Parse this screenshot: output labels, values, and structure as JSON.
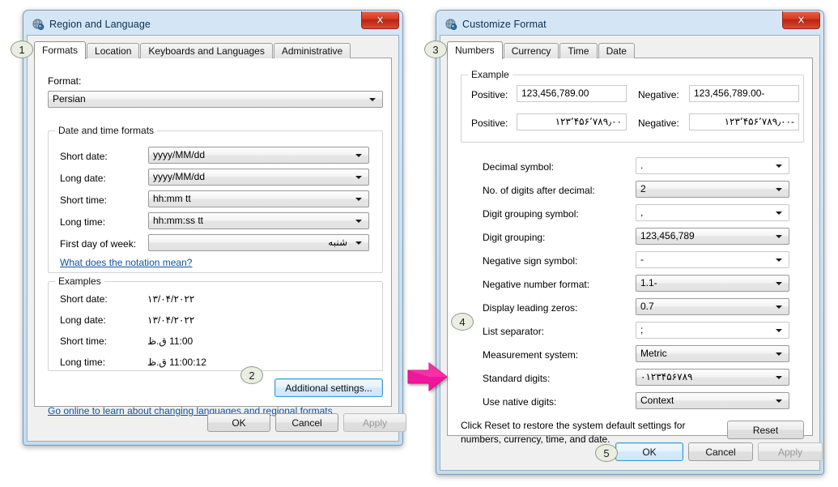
{
  "steps": [
    {
      "n": "1"
    },
    {
      "n": "2"
    },
    {
      "n": "3"
    },
    {
      "n": "4"
    },
    {
      "n": "5"
    }
  ],
  "accent": {
    "arrow_pink": "#F0179C",
    "titlebar_blue": "#CFE2F3",
    "close_red": "#C93017",
    "link_blue": "#1252A0",
    "badge_fill": "#E9EEE0"
  },
  "region_window": {
    "title": "Region and Language",
    "close_label": "x",
    "tabs": [
      {
        "label": "Formats",
        "active": true
      },
      {
        "label": "Location",
        "active": false
      },
      {
        "label": "Keyboards and Languages",
        "active": false
      },
      {
        "label": "Administrative",
        "active": false
      }
    ],
    "format_label": "Format:",
    "format_value": "Persian",
    "datetime_group": {
      "title": "Date and time formats",
      "rows": [
        {
          "label": "Short date:",
          "value": "yyyy/MM/dd",
          "rtl": false
        },
        {
          "label": "Long date:",
          "value": "yyyy/MM/dd",
          "rtl": false
        },
        {
          "label": "Short time:",
          "value": "hh:mm tt",
          "rtl": false
        },
        {
          "label": "Long time:",
          "value": "hh:mm:ss tt",
          "rtl": false
        },
        {
          "label": "First day of week:",
          "value": "شنبه",
          "rtl": true
        }
      ],
      "notation_link": "What does the notation mean?"
    },
    "examples_group": {
      "title": "Examples",
      "rows": [
        {
          "label": "Short date:",
          "value": "۱۳/۰۴/۲۰۲۲"
        },
        {
          "label": "Long date:",
          "value": "۱۳/۰۴/۲۰۲۲"
        },
        {
          "label": "Short time:",
          "value": "11:00 ق.ظ"
        },
        {
          "label": "Long time:",
          "value": "11:00:12 ق.ظ"
        }
      ]
    },
    "additional_settings_label": "Additional settings...",
    "go_online_link": "Go online to learn about changing languages and regional formats",
    "buttons": {
      "ok": "OK",
      "cancel": "Cancel",
      "apply": "Apply"
    }
  },
  "customize_window": {
    "title": "Customize Format",
    "close_label": "x",
    "tabs": [
      {
        "label": "Numbers",
        "active": true
      },
      {
        "label": "Currency",
        "active": false
      },
      {
        "label": "Time",
        "active": false
      },
      {
        "label": "Date",
        "active": false
      }
    ],
    "example_group": {
      "title": "Example",
      "positive_label": "Positive:",
      "negative_label": "Negative:",
      "positive_latin": "123,456,789.00",
      "negative_latin": "123,456,789.00-",
      "positive_native": "۱۲۳٬۴۵۶٬۷۸۹٫۰۰",
      "negative_native": "-۱۲۳٬۴۵۶٬۷۸۹٫۰۰"
    },
    "settings": [
      {
        "label": "Decimal symbol:",
        "value": ".",
        "flat": true
      },
      {
        "label": "No. of digits after decimal:",
        "value": "2",
        "flat": false
      },
      {
        "label": "Digit grouping symbol:",
        "value": ",",
        "flat": true
      },
      {
        "label": "Digit grouping:",
        "value": "123,456,789",
        "flat": false
      },
      {
        "label": "Negative sign symbol:",
        "value": "-",
        "flat": true
      },
      {
        "label": "Negative number format:",
        "value": "1.1-",
        "flat": false
      },
      {
        "label": "Display leading zeros:",
        "value": "0.7",
        "flat": false
      },
      {
        "label": "List separator:",
        "value": ";",
        "flat": true
      },
      {
        "label": "Measurement system:",
        "value": "Metric",
        "flat": false
      },
      {
        "label": "Standard digits:",
        "value": "۰۱۲۳۴۵۶۷۸۹",
        "flat": false
      },
      {
        "label": "Use native digits:",
        "value": "Context",
        "flat": false
      }
    ],
    "reset_text_line1": "Click Reset to restore the system default settings for",
    "reset_text_line2": "numbers, currency, time, and date.",
    "reset_button": "Reset",
    "buttons": {
      "ok": "OK",
      "cancel": "Cancel",
      "apply": "Apply"
    }
  }
}
